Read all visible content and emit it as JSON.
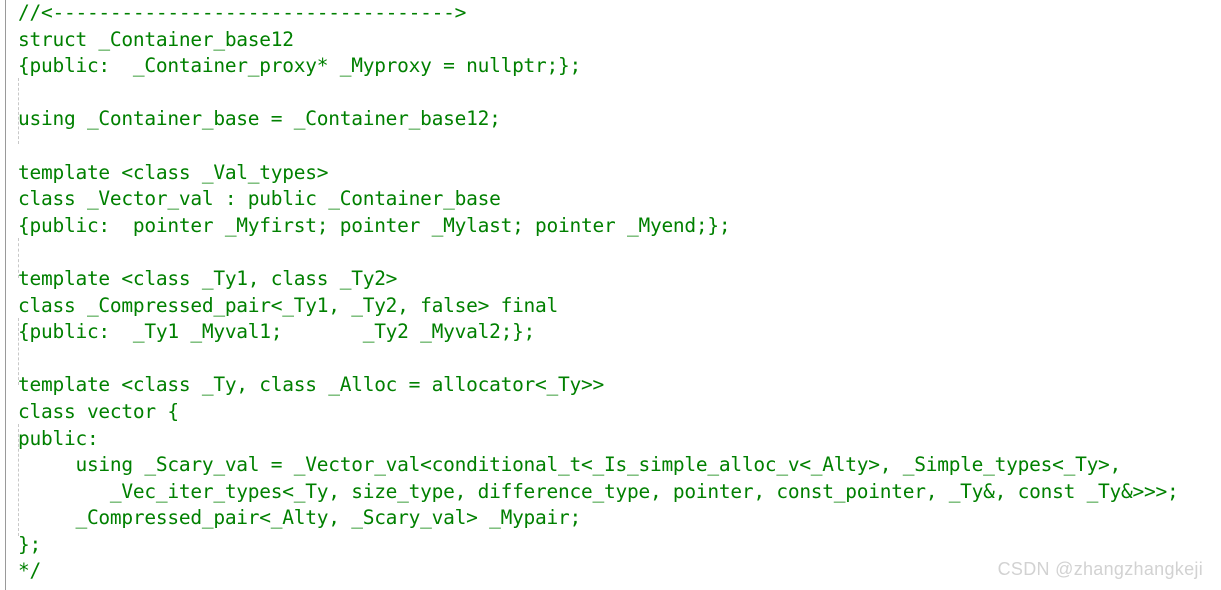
{
  "editor": {
    "language": "cpp",
    "background_color": "#ffffff",
    "comment_color": "#008000",
    "gutter_rule_color": "#9a9a9a",
    "indent_guide_color": "#c8c8c8",
    "code_lines": [
      "//<----------------------------------->",
      "struct _Container_base12",
      "{public:  _Container_proxy* _Myproxy = nullptr;};",
      "",
      "using _Container_base = _Container_base12;",
      "",
      "template <class _Val_types>",
      "class _Vector_val : public _Container_base",
      "{public:  pointer _Myfirst; pointer _Mylast; pointer _Myend;};",
      "",
      "template <class _Ty1, class _Ty2>",
      "class _Compressed_pair<_Ty1, _Ty2, false> final",
      "{public:  _Ty1 _Myval1;       _Ty2 _Myval2;};",
      "",
      "template <class _Ty, class _Alloc = allocator<_Ty>>",
      "class vector {",
      "public:",
      "     using _Scary_val = _Vector_val<conditional_t<_Is_simple_alloc_v<_Alty>, _Simple_types<_Ty>,",
      "        _Vec_iter_types<_Ty, size_type, difference_type, pointer, const_pointer, _Ty&, const _Ty&>>>;",
      "     _Compressed_pair<_Alty, _Scary_val> _Mypair;",
      "};",
      "*/"
    ]
  },
  "watermark": {
    "text": "CSDN @zhangzhangkeji",
    "color": "#d2d2d2"
  }
}
